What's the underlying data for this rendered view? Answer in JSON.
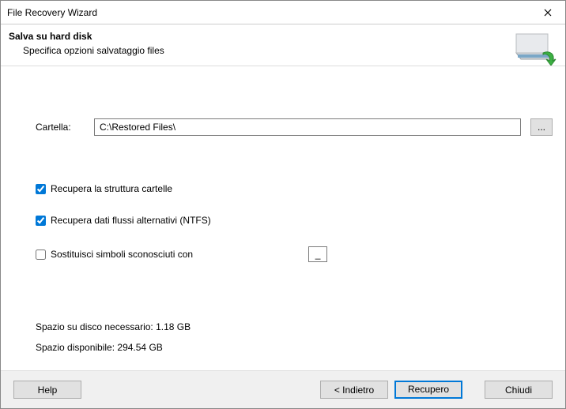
{
  "window": {
    "title": "File Recovery Wizard"
  },
  "header": {
    "title": "Salva su hard disk",
    "subtitle": "Specifica opzioni salvataggio files"
  },
  "form": {
    "folder_label": "Cartella:",
    "folder_value": "C:\\Restored Files\\",
    "browse_label": "...",
    "check_recover_structure": "Recupera la struttura cartelle",
    "check_recover_streams": "Recupera dati flussi alternativi (NTFS)",
    "check_replace_symbols": "Sostituisci simboli sconosciuti con",
    "symbol_value": "_"
  },
  "disk": {
    "required": "Spazio su disco necessario: 1.18 GB",
    "available": "Spazio disponibile: 294.54 GB"
  },
  "footer": {
    "help": "Help",
    "back": "< Indietro",
    "recover": "Recupero",
    "close": "Chiudi"
  }
}
